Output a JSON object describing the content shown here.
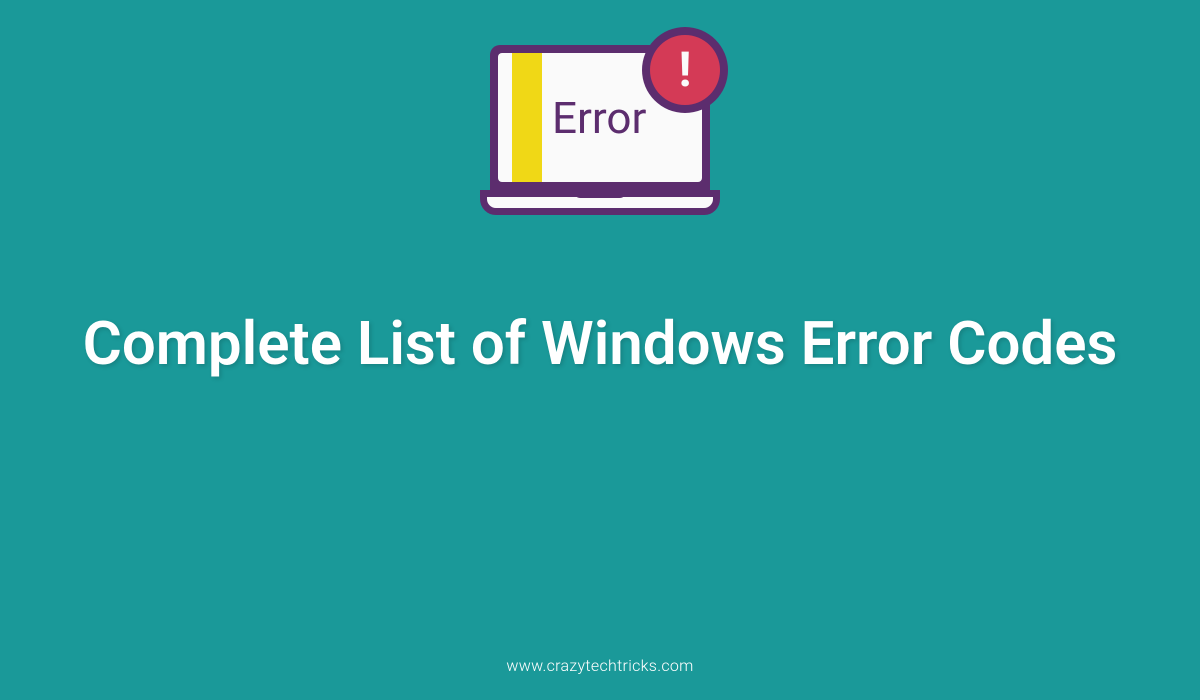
{
  "icon": {
    "error_label": "Error",
    "exclaim": "!"
  },
  "title": "Complete List of Windows Error Codes",
  "footer": {
    "url": "www.crazytechtricks.com"
  },
  "colors": {
    "background": "#1a9999",
    "purple": "#5c2d6e",
    "red": "#d43a56",
    "yellow": "#f0d816",
    "white": "#ffffff"
  }
}
